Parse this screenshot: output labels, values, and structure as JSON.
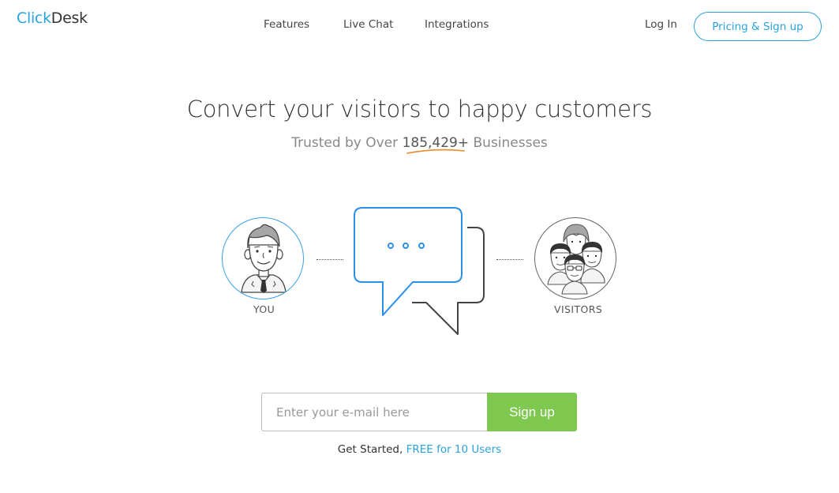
{
  "header": {
    "logo_part1": "Click",
    "logo_part2": "Desk",
    "nav": [
      "Features",
      "Live Chat",
      "Integrations"
    ],
    "login": "Log In",
    "cta": "Pricing & Sign up"
  },
  "hero": {
    "title": "Convert your visitors to happy customers",
    "sub_prefix": "Trusted by Over ",
    "sub_count": "185,429+",
    "sub_suffix": " Businesses"
  },
  "illustration": {
    "left_label": "YOU",
    "right_label": "VISITORS",
    "accent": "#2a8fe8"
  },
  "signup": {
    "placeholder": "Enter your e-mail here",
    "button": "Sign up",
    "note_prefix": "Get Started, ",
    "note_link": "FREE for 10 Users"
  },
  "colors": {
    "brand_blue": "#2aa3e0",
    "signup_green": "#7ec850",
    "swoosh_orange": "#f08a2a"
  }
}
